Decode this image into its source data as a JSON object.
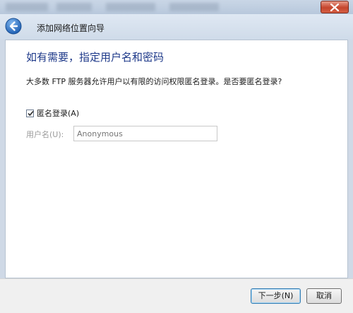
{
  "header": {
    "title": "添加网络位置向导"
  },
  "main": {
    "heading": "如有需要，指定用户名和密码",
    "description": "大多数 FTP 服务器允许用户以有限的访问权限匿名登录。是否要匿名登录?",
    "anonymous_checkbox": {
      "label": "匿名登录(A)",
      "checked": true
    },
    "username": {
      "label": "用户名(U):",
      "placeholder": "Anonymous"
    }
  },
  "footer": {
    "next_label": "下一步(N)",
    "cancel_label": "取消"
  },
  "colors": {
    "heading": "#1f3a8a",
    "close_button": "#c5452d"
  },
  "icons": {
    "back": "back-arrow-icon",
    "close": "close-icon",
    "check": "checkmark-icon"
  }
}
